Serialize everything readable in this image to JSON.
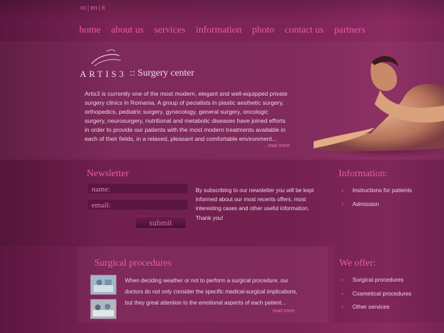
{
  "languages": [
    "ro",
    "en",
    "it"
  ],
  "nav": [
    "home",
    "about us",
    "services",
    "information",
    "photo",
    "contact us",
    "partners"
  ],
  "brand": {
    "name": "ARTIS3",
    "tagline": ":: Surgery center"
  },
  "intro": {
    "lines": [
      "Artis3 is currently one of the most modern, elegant and well-equipped private",
      "surgery clinics in Romania. A group of pecialists in plastic aesthetic surgery,",
      "orthopedics, pediatric surgery, gynecology, general surgery, oncologic",
      "surgery, neurosurgery, nutritional and metabolic diseases have joined efforts",
      "in order to provide our patients with the most modern treatments available in",
      "each of their fields, in a relaxed, pleasant and comfortable environment..."
    ],
    "read_more": "... read more"
  },
  "newsletter": {
    "title": "Newsletter",
    "name_placeholder": "name:",
    "email_placeholder": "email:",
    "submit": "submit",
    "text_lines": [
      "By subscribing to our newsletter you will be kept",
      "informed about our most recents offers, most",
      "interesting cases and other useful information.",
      "Thank you!"
    ]
  },
  "information": {
    "title": "Information:",
    "items": [
      "Instructions for patients",
      "Admission"
    ]
  },
  "surgical": {
    "title": "Surgical procedures",
    "text_lines": [
      "When deciding weather or not to perform a surgical procedure, our",
      "doctors do not only consider the specific medical-surgical implications,",
      "but they great attention to the emotional aspects of each patient..."
    ],
    "read_more": "read more"
  },
  "offer": {
    "title": "We offer:",
    "items": [
      "Surgical procedures",
      "Cosmetical procedures",
      "Other services"
    ]
  },
  "colors": {
    "background": "#6e1d4d",
    "accent": "#ec5aa9",
    "text": "#f0d3e4"
  }
}
